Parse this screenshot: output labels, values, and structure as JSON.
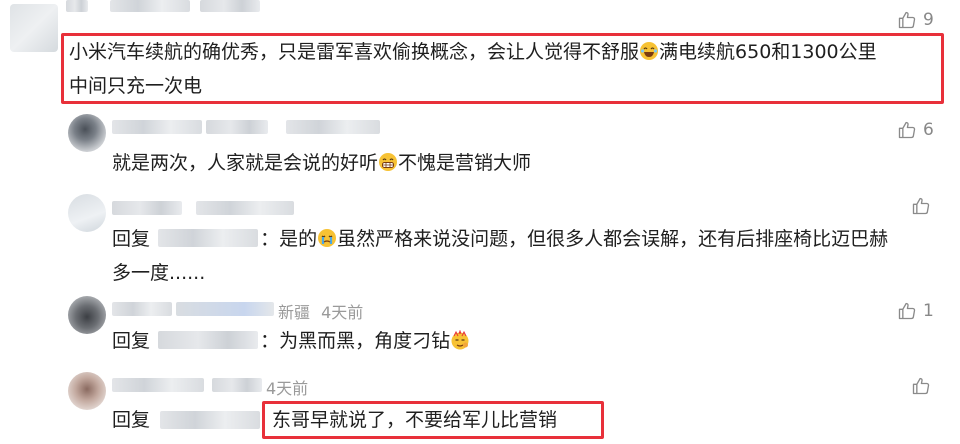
{
  "comments": [
    {
      "likes": "9",
      "text_line1": "小米汽车续航的确优秀，只是雷军喜欢偷换概念，会让人觉得不舒服",
      "text_line1_tail": "满电续航650和1300公里",
      "text_line2": "中间只充一次电",
      "emoji": "laugh-tears-emoji"
    },
    {
      "likes": "6",
      "text_a": "就是两次，人家就是会说的好听",
      "text_b": "不愧是营销大师",
      "emoji": "grin-emoji"
    },
    {
      "likes": "",
      "reply_prefix": "回复",
      "text_a": "：是的",
      "text_b": "虽然严格来说没问题，但很多人都会误解，还有后排座椅比迈巴赫",
      "text_line2": "多一度......",
      "emoji": "crying-emoji"
    },
    {
      "likes": "1",
      "location": "新疆",
      "time": "4天前",
      "reply_prefix": "回复",
      "text_a": "：为黑而黑，角度刁钻",
      "emoji": "sarcastic-emoji"
    },
    {
      "likes": "",
      "time": "4天前",
      "reply_prefix": "回复",
      "text_a": "东哥早就说了，不要给军儿比营销"
    }
  ],
  "colors": {
    "highlight": "#e8303a",
    "meta": "#9a9a9a",
    "text": "#1f1f1f"
  }
}
